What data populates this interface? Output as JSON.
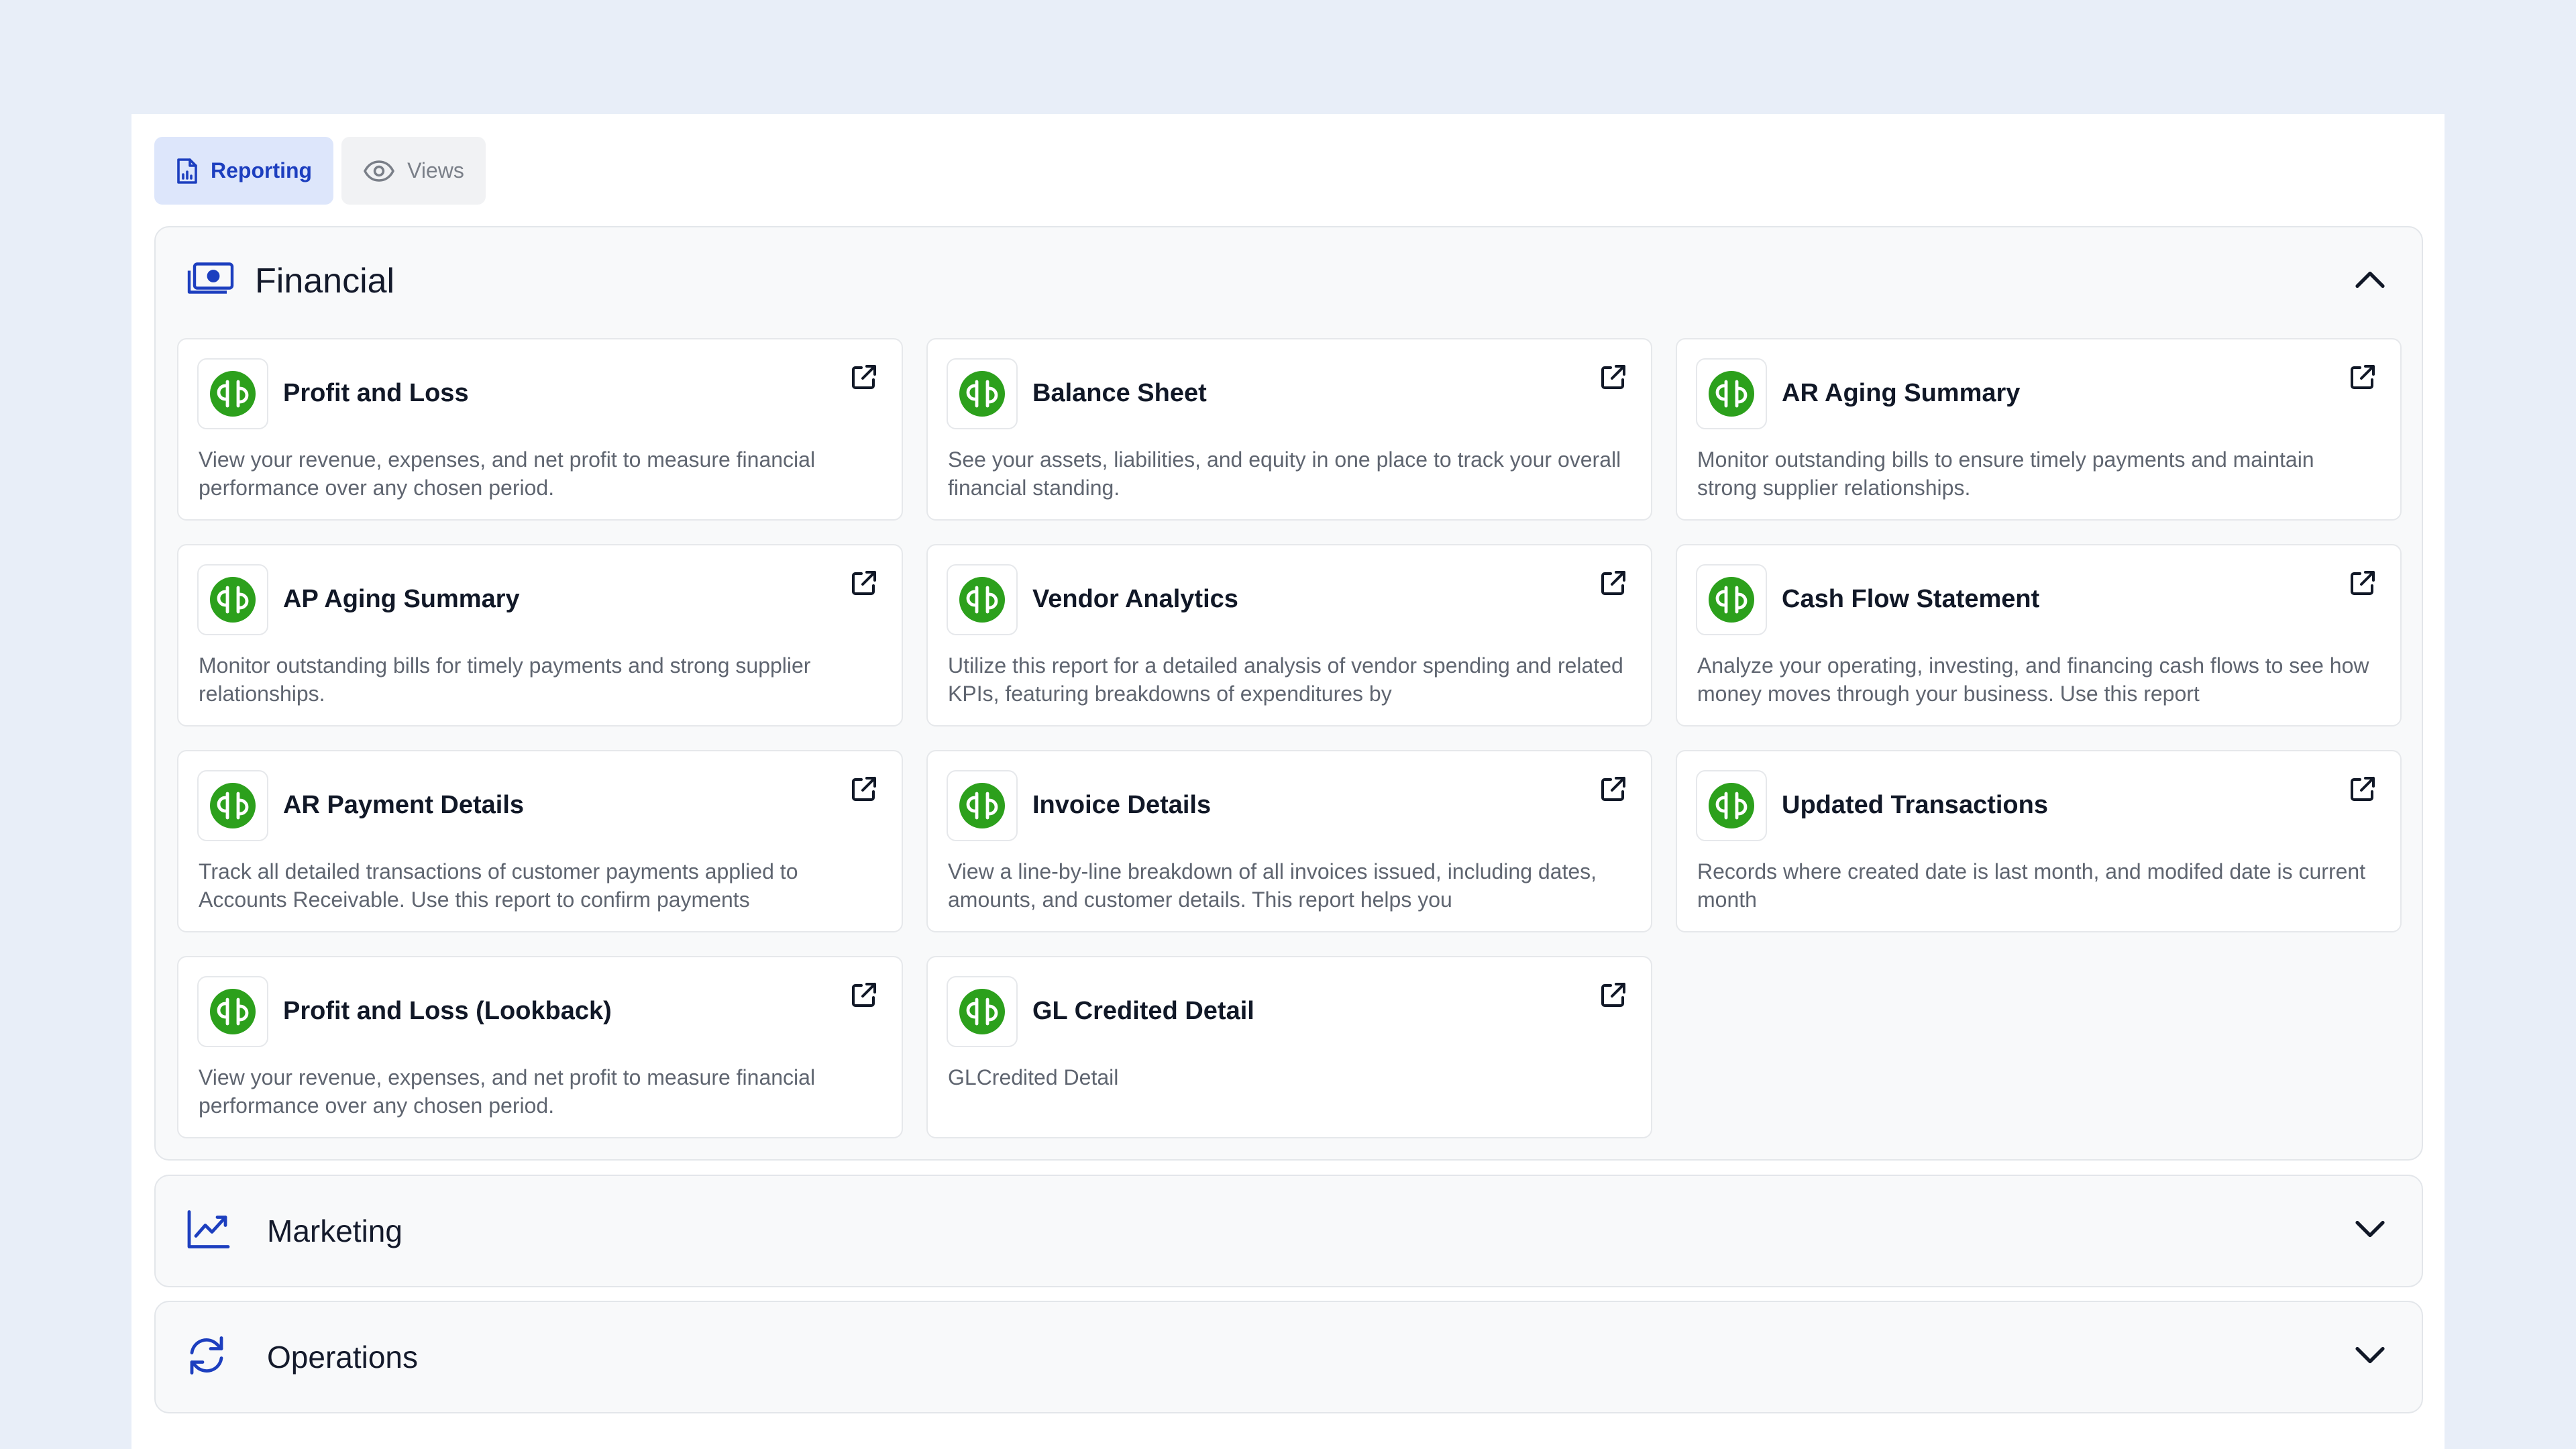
{
  "tabs": [
    {
      "label": "Reporting",
      "icon": "report-file-icon",
      "active": true
    },
    {
      "label": "Views",
      "icon": "eye-icon",
      "active": false
    }
  ],
  "sections": {
    "financial": {
      "title": "Financial",
      "icon": "money-icon",
      "expanded": true
    },
    "marketing": {
      "title": "Marketing",
      "icon": "trending-chart-icon",
      "expanded": false
    },
    "operations": {
      "title": "Operations",
      "icon": "refresh-icon",
      "expanded": false
    }
  },
  "reports": [
    {
      "title": "Profit and Loss",
      "desc": "View your revenue, expenses, and net profit to measure financial performance over any chosen period."
    },
    {
      "title": "Balance Sheet",
      "desc": "See your assets, liabilities, and equity in one place to track your overall financial standing."
    },
    {
      "title": "AR Aging Summary",
      "desc": "Monitor outstanding bills to ensure timely payments and maintain strong supplier relationships."
    },
    {
      "title": "AP Aging Summary",
      "desc": "Monitor outstanding bills for timely payments and strong supplier relationships."
    },
    {
      "title": "Vendor Analytics",
      "desc": "Utilize this report for a detailed analysis of vendor spending and related KPIs, featuring breakdowns of expenditures by"
    },
    {
      "title": "Cash Flow Statement",
      "desc": "Analyze your operating, investing, and financing cash flows to see how money moves through your business. Use this report"
    },
    {
      "title": "AR Payment Details",
      "desc": "Track all detailed transactions of customer payments applied to Accounts Receivable. Use this report to confirm payments"
    },
    {
      "title": "Invoice Details",
      "desc": "View a line-by-line breakdown of all invoices issued, including dates, amounts, and customer details. This report helps you"
    },
    {
      "title": "Updated Transactions",
      "desc": "Records where created date is last month, and modifed date is current month"
    },
    {
      "title": "Profit and Loss (Lookback)",
      "desc": "View your revenue, expenses, and net profit to measure financial performance over any chosen period."
    },
    {
      "title": "GL Credited Detail",
      "desc": "GLCredited Detail"
    }
  ],
  "colors": {
    "accent": "#1d3fbf",
    "quickbooks_green": "#2ca01c",
    "background": "#e8eef8"
  }
}
